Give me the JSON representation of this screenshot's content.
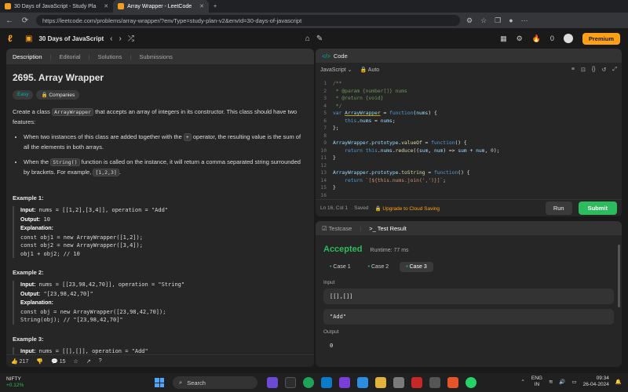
{
  "browser": {
    "tabs": [
      {
        "title": "30 Days of JavaScript - Study Pla"
      },
      {
        "title": "Array Wrapper - LeetCode"
      }
    ],
    "url": "https://leetcode.com/problems/array-wrapper/?envType=study-plan-v2&envId=30-days-of-javascript"
  },
  "header": {
    "study_plan": "30 Days of JavaScript",
    "streak": "0",
    "premium": "Premium"
  },
  "left": {
    "tabs": [
      "Description",
      "Editorial",
      "Solutions",
      "Submissions"
    ],
    "title": "2695. Array Wrapper",
    "difficulty": "Easy",
    "companies": "Companies",
    "desc1": "Create a class",
    "desc_code": "ArrayWrapper",
    "desc2": "that accepts an array of integers in its constructor. This class should have two features:",
    "bullet1a": "When two instances of this class are added together with the",
    "bullet1_op": "+",
    "bullet1b": "operator, the resulting value is the sum of all the elements in both arrays.",
    "bullet2a": "When the",
    "bullet2_code": "String()",
    "bullet2b": "function is called on the instance, it will return a comma separated string surrounded by brackets. For example,",
    "bullet2_ex": "[1,2,3]",
    "ex1_title": "Example 1:",
    "ex1_input_l": "Input:",
    "ex1_input": "nums = [[1,2],[3,4]], operation = \"Add\"",
    "ex1_output_l": "Output:",
    "ex1_output": "10",
    "ex1_expl_l": "Explanation:",
    "ex1_l1": "const obj1 = new ArrayWrapper([1,2]);",
    "ex1_l2": "const obj2 = new ArrayWrapper([3,4]);",
    "ex1_l3": "obj1 + obj2; // 10",
    "ex2_title": "Example 2:",
    "ex2_input": "nums = [[23,98,42,70]], operation = \"String\"",
    "ex2_output": "\"[23,98,42,70]\"",
    "ex2_l1": "const obj = new ArrayWrapper([23,98,42,70]);",
    "ex2_l2": "String(obj); // \"[23,98,42,70]\"",
    "ex3_title": "Example 3:",
    "ex3_input": "nums = [[],[]], operation = \"Add\"",
    "likes": "217",
    "comments": "15"
  },
  "code": {
    "tab": "Code",
    "language": "JavaScript",
    "mode": "Auto",
    "status": "Ln 16, Col 1",
    "saved": "Saved",
    "upgrade": "Upgrade to Cloud Saving",
    "run": "Run",
    "submit": "Submit"
  },
  "result": {
    "tabs": [
      "Testcase",
      "Test Result"
    ],
    "status": "Accepted",
    "runtime": "Runtime: 77 ms",
    "cases": [
      "Case 1",
      "Case 2",
      "Case 3"
    ],
    "input_label": "Input",
    "input1": "[[],[]]",
    "input2": "\"Add\"",
    "output_label": "Output",
    "output": "0"
  },
  "taskbar": {
    "ticker": "NIFTY",
    "change": "+0.12%",
    "search": "Search",
    "lang1": "ENG",
    "lang2": "IN",
    "time": "09:34",
    "date": "26-04-2024"
  }
}
